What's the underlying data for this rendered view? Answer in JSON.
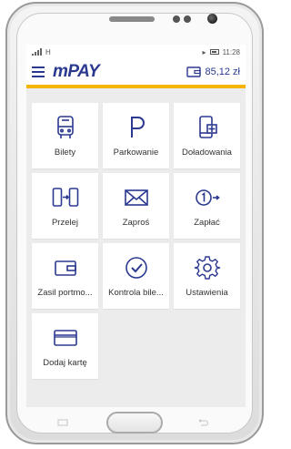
{
  "status": {
    "network": "H",
    "time": "11:28"
  },
  "header": {
    "logo": "mPAY",
    "balance": "85,12 zł"
  },
  "tiles": [
    {
      "label": "Bilety",
      "icon": "bus-icon"
    },
    {
      "label": "Parkowanie",
      "icon": "parking-icon"
    },
    {
      "label": "Doładowania",
      "icon": "phone-topup-icon"
    },
    {
      "label": "Przelej",
      "icon": "transfer-phones-icon"
    },
    {
      "label": "Zaproś",
      "icon": "envelope-icon"
    },
    {
      "label": "Zapłać",
      "icon": "pay-arrow-icon"
    },
    {
      "label": "Zasil portmo...",
      "icon": "wallet-icon"
    },
    {
      "label": "Kontrola bile...",
      "icon": "check-circle-icon"
    },
    {
      "label": "Ustawienia",
      "icon": "gear-icon"
    },
    {
      "label": "Dodaj kartę",
      "icon": "card-icon"
    }
  ],
  "colors": {
    "brand": "#2b3990",
    "accent": "#f4b400",
    "background": "#ececec"
  }
}
